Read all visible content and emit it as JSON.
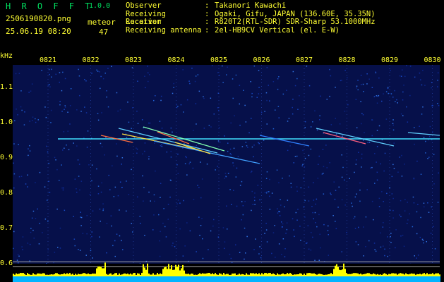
{
  "app": {
    "name": "H R O F F T",
    "version": "1.0.0"
  },
  "file": {
    "name": "2506190820.png",
    "datetime": "25.06.19 08:20"
  },
  "detection": {
    "label": "meteor",
    "count": "47"
  },
  "meta": [
    {
      "key": "Observer",
      "value": "Takanori Kawachi"
    },
    {
      "key": "Receiving Location",
      "value": "Ogaki, Gifu, JAPAN (136.60E, 35.35N)"
    },
    {
      "key": "Receiver",
      "value": "R820T2(RTL-SDR) SDR-Sharp 53.1000MHz"
    },
    {
      "key": "Receiving antenna",
      "value": "2el-HB9CV Vertical (el. E-W)"
    }
  ],
  "axis": {
    "unit": "kHz",
    "freq_ticks": [
      "1.1",
      "1.0",
      "0.9",
      "0.8",
      "0.7",
      "0.6"
    ],
    "time_ticks": [
      "0821",
      "0822",
      "0823",
      "0824",
      "0825",
      "0826",
      "0827",
      "0828",
      "0829",
      "0830"
    ]
  },
  "colors": {
    "label": "#ffff33",
    "brand": "#00e060",
    "background": "#06104a",
    "carrier": "#40e0ff",
    "level": "#ffff00",
    "level_base": "#00b4ff"
  }
}
